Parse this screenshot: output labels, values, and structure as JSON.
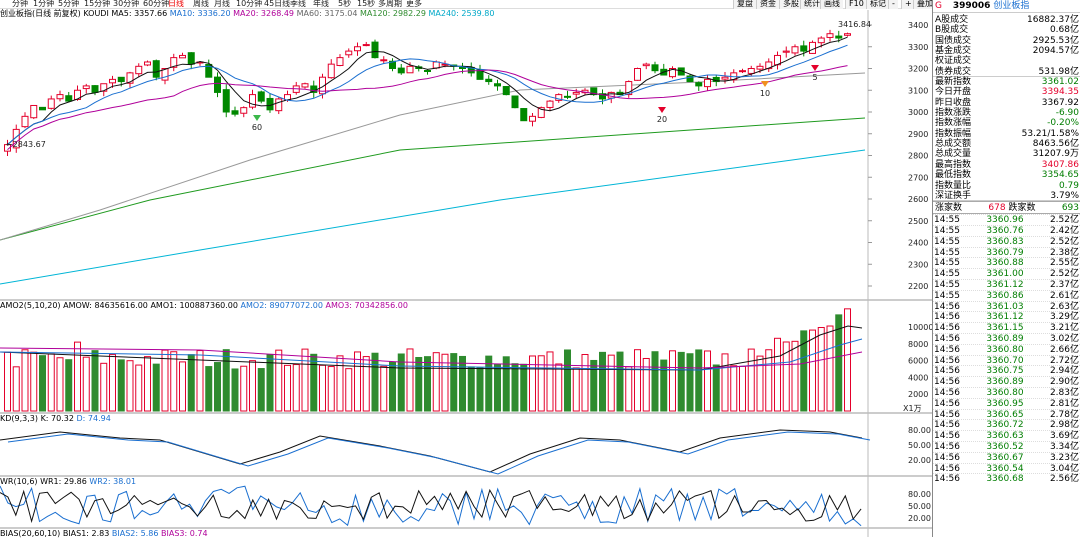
{
  "period_tabs": [
    "分钟",
    "1分钟",
    "5分钟",
    "15分钟",
    "30分钟",
    "60分钟",
    "日线",
    "周线",
    "月线",
    "10分钟",
    "45日线",
    "季线",
    "年线",
    "5秒",
    "15秒",
    "多周期",
    "更多"
  ],
  "active_tab": "日线",
  "right_buttons": [
    "复盘",
    "资金",
    "多股",
    "统计",
    "画线",
    "F10",
    "标记",
    "-",
    "+",
    "叠加",
    "还原"
  ],
  "main": {
    "legend": {
      "name": "创业板指(日线 前复权)",
      "ind": "KOUDI",
      "ma5": "MA5: 3357.66",
      "ma10": "MA10: 3336.20",
      "ma20": "MA20: 3268.49",
      "ma60": "MA60: 3175.04",
      "ma120": "MA120: 2982.29",
      "ma240": "MA240: 2539.80"
    },
    "axis": [
      "3400",
      "3300",
      "3200",
      "3100",
      "3000",
      "2900",
      "2800",
      "2700",
      "2600",
      "2500",
      "2400",
      "2300",
      "2200"
    ],
    "hi_label": "3416.84",
    "lo_label": "2843.67",
    "markers": [
      {
        "t": "60"
      },
      {
        "t": "20"
      },
      {
        "t": "10"
      },
      {
        "t": "5"
      }
    ]
  },
  "vol": {
    "legend": {
      "a": "AMO2(5,10,20)",
      "b": "AMOW: 84635616.00",
      "c": "AMO1: 100887360.00",
      "d": "AMO2: 89077072.00",
      "e": "AMO3: 70342856.00"
    },
    "axis": [
      "10000",
      "8000",
      "6000",
      "4000",
      "2000"
    ],
    "unit": "X1万"
  },
  "kd": {
    "legend": {
      "a": "KD(9,3,3)",
      "k": "K: 70.32",
      "d": "D: 74.94"
    },
    "axis": [
      "80.00",
      "50.00",
      "20.00"
    ]
  },
  "wr": {
    "legend": {
      "a": "WR(10,6)",
      "w1": "WR1: 29.86",
      "w2": "WR2: 38.01"
    },
    "axis": [
      "80.00",
      "50.00",
      "20.00"
    ]
  },
  "bias": {
    "legend": {
      "a": "BIAS(20,60,10)",
      "b1": "BIAS1: 2.83",
      "b2": "BIAS2: 5.86",
      "b3": "BIAS3: 0.74"
    }
  },
  "panel": {
    "code": "399006",
    "name": "创业板指",
    "g": "G",
    "stats": [
      {
        "label": "A股成交",
        "value": "16882.37亿",
        "cls": ""
      },
      {
        "label": "B股成交",
        "value": "0.68亿",
        "cls": ""
      },
      {
        "label": "国债成交",
        "value": "2925.53亿",
        "cls": ""
      },
      {
        "label": "基金成交",
        "value": "2094.57亿",
        "cls": ""
      },
      {
        "label": "权证成交",
        "value": "",
        "cls": ""
      },
      {
        "label": "债券成交",
        "value": "531.98亿",
        "cls": ""
      },
      {
        "label": "最新指数",
        "value": "3361.02",
        "cls": "grn"
      },
      {
        "label": "今日开盘",
        "value": "3394.35",
        "cls": "red"
      },
      {
        "label": "昨日收盘",
        "value": "3367.92",
        "cls": ""
      },
      {
        "label": "指数涨跌",
        "value": "-6.90",
        "cls": "grn"
      },
      {
        "label": "指数涨幅",
        "value": "-0.20%",
        "cls": "grn"
      },
      {
        "label": "指数振幅",
        "value": "53.21/1.58%",
        "cls": ""
      },
      {
        "label": "总成交额",
        "value": "8463.56亿",
        "cls": ""
      },
      {
        "label": "总成交量",
        "value": "31207.9万",
        "cls": ""
      },
      {
        "label": "最高指数",
        "value": "3407.86",
        "cls": "red"
      },
      {
        "label": "最低指数",
        "value": "3354.65",
        "cls": "grn"
      },
      {
        "label": "指数量比",
        "value": "0.79",
        "cls": "grn"
      },
      {
        "label": "深证换手",
        "value": "3.79%",
        "cls": ""
      }
    ],
    "up_label": "涨家数",
    "up": "678",
    "down_label": "跌家数",
    "down": "693",
    "ticks": [
      [
        "14:55",
        "3360.96",
        "2.52亿"
      ],
      [
        "14:55",
        "3360.76",
        "2.42亿"
      ],
      [
        "14:55",
        "3360.83",
        "2.52亿"
      ],
      [
        "14:55",
        "3360.79",
        "2.38亿"
      ],
      [
        "14:55",
        "3360.88",
        "2.55亿"
      ],
      [
        "14:55",
        "3361.00",
        "2.52亿"
      ],
      [
        "14:55",
        "3361.12",
        "2.37亿"
      ],
      [
        "14:55",
        "3360.86",
        "2.61亿"
      ],
      [
        "14:56",
        "3361.03",
        "2.63亿"
      ],
      [
        "14:56",
        "3361.12",
        "3.29亿"
      ],
      [
        "14:56",
        "3361.15",
        "3.21亿"
      ],
      [
        "14:56",
        "3360.89",
        "3.02亿"
      ],
      [
        "14:56",
        "3360.80",
        "2.66亿"
      ],
      [
        "14:56",
        "3360.70",
        "2.72亿"
      ],
      [
        "14:56",
        "3360.75",
        "2.94亿"
      ],
      [
        "14:56",
        "3360.89",
        "2.90亿"
      ],
      [
        "14:56",
        "3360.80",
        "2.83亿"
      ],
      [
        "14:56",
        "3360.95",
        "2.81亿"
      ],
      [
        "14:56",
        "3360.65",
        "2.78亿"
      ],
      [
        "14:56",
        "3360.72",
        "2.98亿"
      ],
      [
        "14:56",
        "3360.63",
        "3.69亿"
      ],
      [
        "14:56",
        "3360.52",
        "3.34亿"
      ],
      [
        "14:56",
        "3360.67",
        "3.23亿"
      ],
      [
        "14:56",
        "3360.54",
        "3.04亿"
      ],
      [
        "14:56",
        "3360.68",
        "2.56亿"
      ]
    ]
  }
}
